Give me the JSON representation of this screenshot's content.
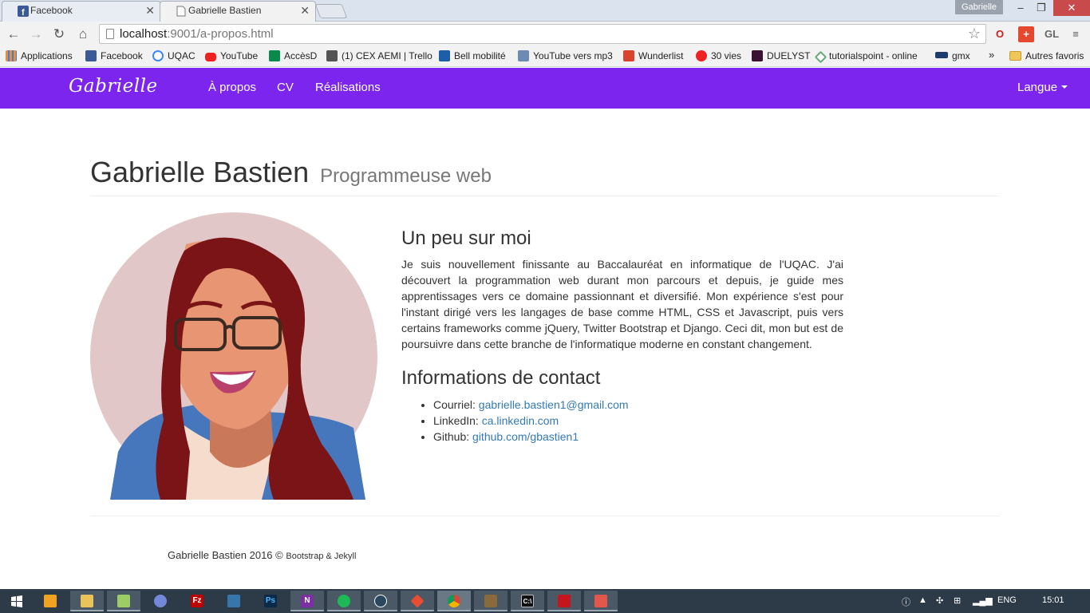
{
  "browser": {
    "tabs": [
      {
        "title": "Facebook",
        "active": false
      },
      {
        "title": "Gabrielle Bastien",
        "active": true
      }
    ],
    "profile": "Gabrielle",
    "url": {
      "host": "localhost",
      "path": ":9001/a-propos.html"
    },
    "extension_gl": "GL",
    "bookmarks": [
      {
        "label": "Applications",
        "icon": "apps-grid-icon"
      },
      {
        "label": "Facebook",
        "icon": "facebook-icon"
      },
      {
        "label": "UQAC",
        "icon": "google-icon"
      },
      {
        "label": "YouTube",
        "icon": "youtube-icon"
      },
      {
        "label": "AccèsD",
        "icon": "desjardins-icon"
      },
      {
        "label": "(1) CEX AEMI | Trello",
        "icon": "trello-icon"
      },
      {
        "label": "Bell mobilité",
        "icon": "bell-icon"
      },
      {
        "label": "YouTube vers mp3",
        "icon": "mp3-icon"
      },
      {
        "label": "Wunderlist",
        "icon": "wunderlist-icon"
      },
      {
        "label": "30 vies",
        "icon": "radio-canada-icon"
      },
      {
        "label": "DUELYST",
        "icon": "duelyst-icon"
      },
      {
        "label": "tutorialspoint - online",
        "icon": "tutorialspoint-icon"
      },
      {
        "label": "gmx",
        "icon": "gmx-icon"
      }
    ],
    "bookmarks_overflow": "»",
    "other_bookmarks": "Autres favoris"
  },
  "site": {
    "brand": "Gabrielle",
    "nav": [
      "À propos",
      "CV",
      "Réalisations"
    ],
    "language": "Langue"
  },
  "header": {
    "name": "Gabrielle Bastien",
    "subtitle": "Programmeuse web"
  },
  "about": {
    "title": "Un peu sur moi",
    "text": "Je suis nouvellement finissante au Baccalauréat en informatique de l'UQAC. J'ai découvert la programmation web durant mon parcours et depuis, je guide mes apprentissages vers ce domaine passionnant et diversifié. Mon expérience s'est pour l'instant dirigé vers les langages de base comme HTML, CSS et Javascript, puis vers certains frameworks comme jQuery, Twitter Bootstrap et Django. Ceci dit, mon but est de poursuivre dans cette branche de l'informatique moderne en constant changement."
  },
  "contact": {
    "title": "Informations de contact",
    "items": [
      {
        "label": "Courriel:",
        "value": "gabrielle.bastien1@gmail.com"
      },
      {
        "label": "LinkedIn:",
        "value": "ca.linkedin.com"
      },
      {
        "label": "Github:",
        "value": "github.com/gbastien1"
      }
    ]
  },
  "footer": {
    "text": "Gabrielle Bastien 2016 ©",
    "credit": "Bootstrap & Jekyll"
  },
  "taskbar": {
    "language": "ENG",
    "time": "15:01"
  },
  "colors": {
    "navbar": "#7b25ee",
    "link": "#337ab7",
    "avatar_bg": "#e2c7c9",
    "hair": "#7a1416",
    "jacket": "#4677bd"
  }
}
